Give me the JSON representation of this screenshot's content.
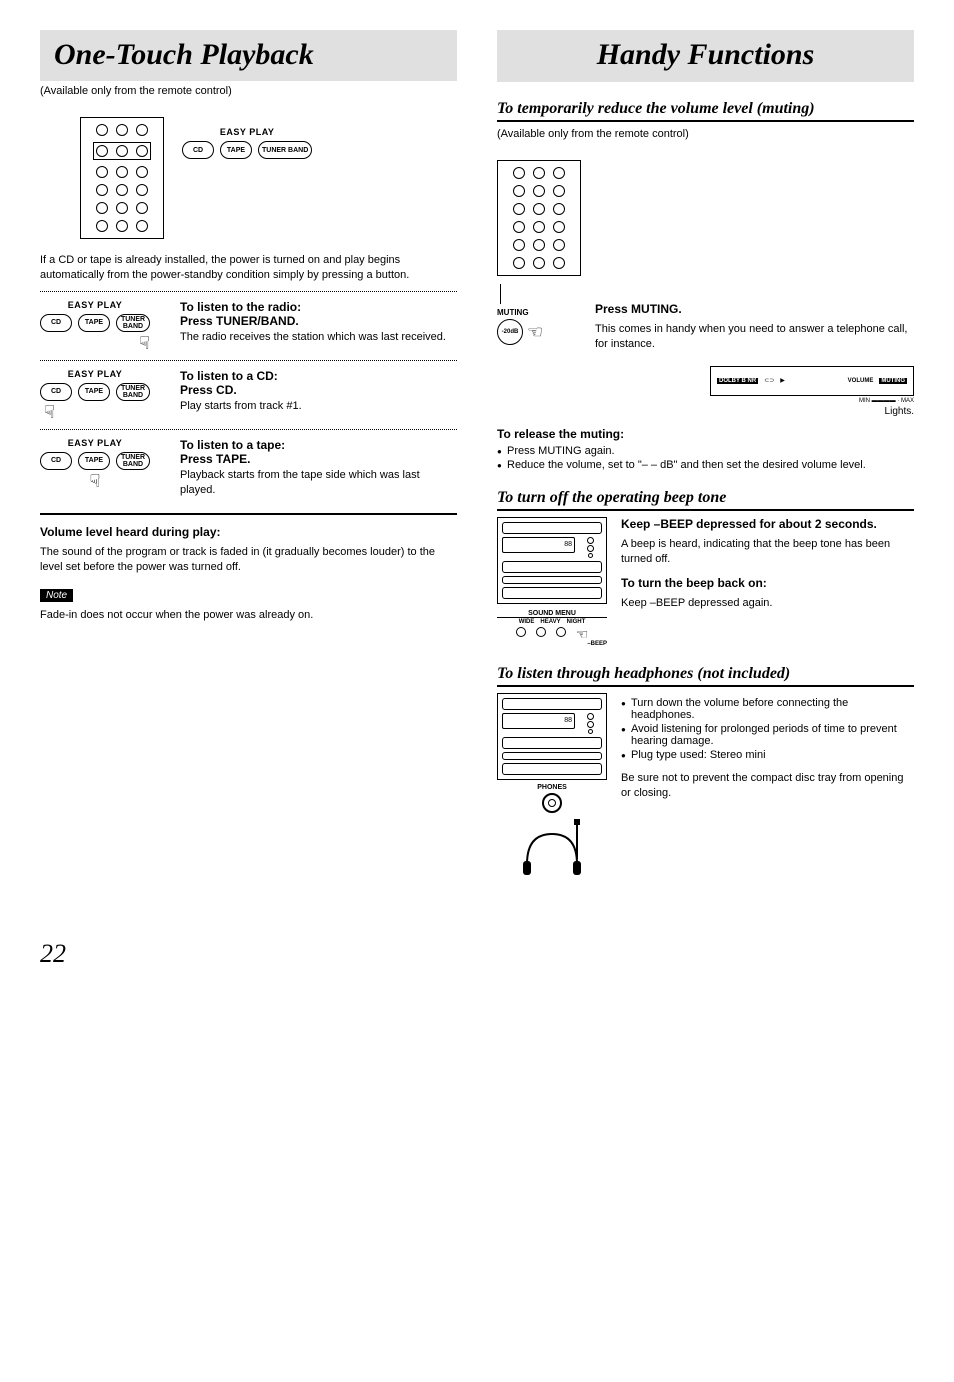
{
  "left": {
    "title": "One-Touch Playback",
    "availability": "(Available only from the remote control)",
    "easy_play_label": "EASY PLAY",
    "pill_cd": "CD",
    "pill_tape": "TAPE",
    "pill_tuner": "TUNER BAND",
    "intro": "If a CD or tape is already installed, the power is turned on and play begins automatically from the power-standby condition simply by pressing a button.",
    "radio": {
      "title": "To listen to the radio:",
      "action": "Press TUNER/BAND.",
      "body": "The radio receives the station which was last received."
    },
    "cd": {
      "title": "To listen to a CD:",
      "action": "Press CD.",
      "body": "Play starts from track #1."
    },
    "tape": {
      "title": "To listen to a tape:",
      "action": "Press TAPE.",
      "body": "Playback starts from the tape side which was last played."
    },
    "vol_head": "Volume level heard during play:",
    "vol_body": "The sound of the program or track is faded in (it gradually becomes louder) to the level set before the power was turned off.",
    "note_label": "Note",
    "note_body": "Fade-in does not occur when the power was already on."
  },
  "right": {
    "title": "Handy Functions",
    "muting": {
      "section": "To temporarily reduce the volume level (muting)",
      "availability": "(Available only from the remote control)",
      "label": "MUTING",
      "btn": "-20dB",
      "press_head": "Press MUTING.",
      "press_body": "This comes in handy when you need to answer a telephone call, for instance.",
      "display_dolby": "DOLBY B NR",
      "display_cd": "⊂⊃",
      "display_vol": "VOLUME",
      "display_muting": "MUTING",
      "display_min": "MIN",
      "display_max": "MAX",
      "lights": "Lights.",
      "release_head": "To release the muting:",
      "release_b1": "Press MUTING again.",
      "release_b2": "Reduce the volume, set to \"– – dB\" and then set the desired volume level."
    },
    "beep": {
      "section": "To turn off the operating beep tone",
      "keep_head": "Keep –BEEP depressed for about 2 seconds.",
      "keep_body": "A beep is heard, indicating that the beep tone has been turned off.",
      "on_head": "To turn the beep back on:",
      "on_body": "Keep –BEEP depressed again.",
      "sound_menu": "SOUND MENU",
      "sm_wide": "WIDE",
      "sm_heavy": "HEAVY",
      "sm_night": "NIGHT",
      "beep_lbl": "–BEEP"
    },
    "phones": {
      "section": "To listen through headphones (not included)",
      "b1": "Turn down the volume before connecting the headphones.",
      "b2": "Avoid listening for prolonged periods of time to prevent hearing damage.",
      "b3": "Plug type used: Stereo mini",
      "closing": "Be sure not to prevent the compact disc tray from opening or closing.",
      "label": "PHONES"
    }
  },
  "page": "22"
}
